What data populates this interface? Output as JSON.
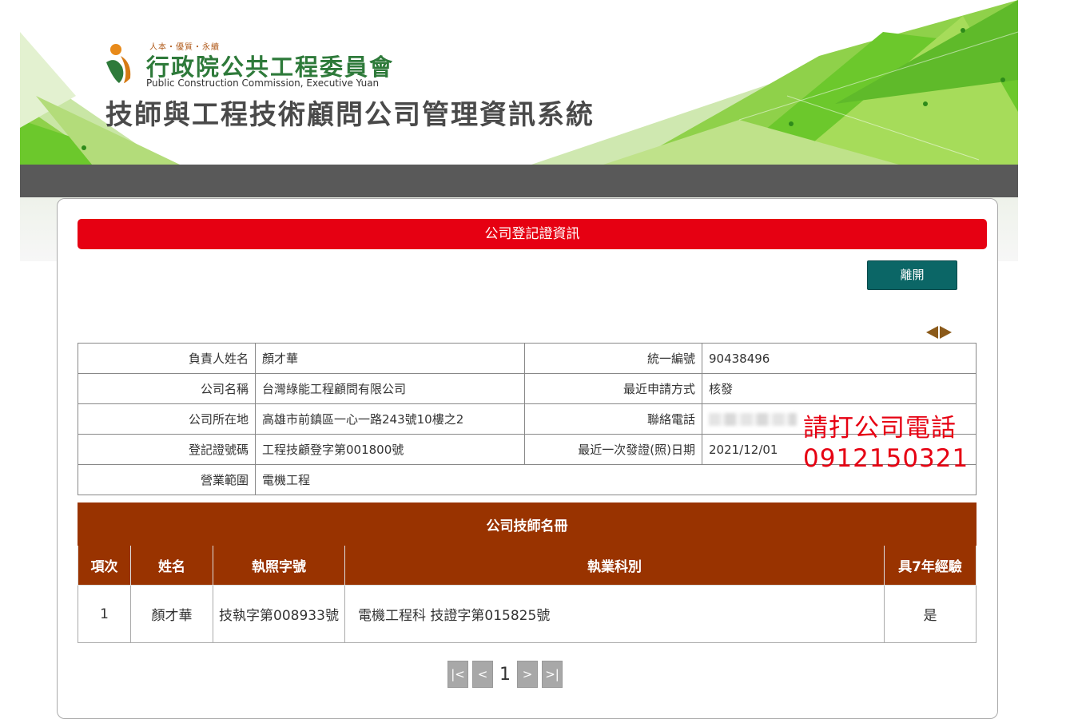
{
  "header": {
    "tagline": "人本・優質・永續",
    "agency_name": "行政院公共工程委員會",
    "agency_en": "Public Construction Commission, Executive Yuan",
    "system_title": "技師與工程技術顧問公司管理資訊系統"
  },
  "section_title": "公司登記證資訊",
  "leave_button": "離開",
  "icons": {
    "prev": "prev-record-icon",
    "next": "next-record-icon"
  },
  "company_info": {
    "rows": [
      {
        "l1": "負責人姓名",
        "v1": "顏才華",
        "l2": "統一編號",
        "v2": "90438496"
      },
      {
        "l1": "公司名稱",
        "v1": "台灣綠能工程顧問有限公司",
        "l2": "最近申請方式",
        "v2": "核發"
      },
      {
        "l1": "公司所在地",
        "v1": "高雄市前鎮區一心一路243號10樓之2",
        "l2": "聯絡電話",
        "v2": ""
      },
      {
        "l1": "登記證號碼",
        "v1": "工程技顧登字第001800號",
        "l2": "最近一次發證(照)日期",
        "v2": "2021/12/01"
      },
      {
        "l1": "營業範圍",
        "v1": "電機工程"
      }
    ]
  },
  "annotation": {
    "line1": "請打公司電話",
    "line2": "0912150321"
  },
  "engineer_table": {
    "title": "公司技師名冊",
    "headers": [
      "項次",
      "姓名",
      "執照字號",
      "執業科別",
      "具7年經驗"
    ],
    "rows": [
      [
        "1",
        "顏才華",
        "技執字第008933號",
        "電機工程科 技證字第015825號",
        "是"
      ]
    ]
  },
  "pager": {
    "first": "|<",
    "prev": "<",
    "current": "1",
    "next": ">",
    "last": ">|"
  },
  "colors": {
    "accent_red": "#e60012",
    "table_header": "#993300",
    "button_teal": "#0b6666",
    "nav_grey": "#595959"
  }
}
